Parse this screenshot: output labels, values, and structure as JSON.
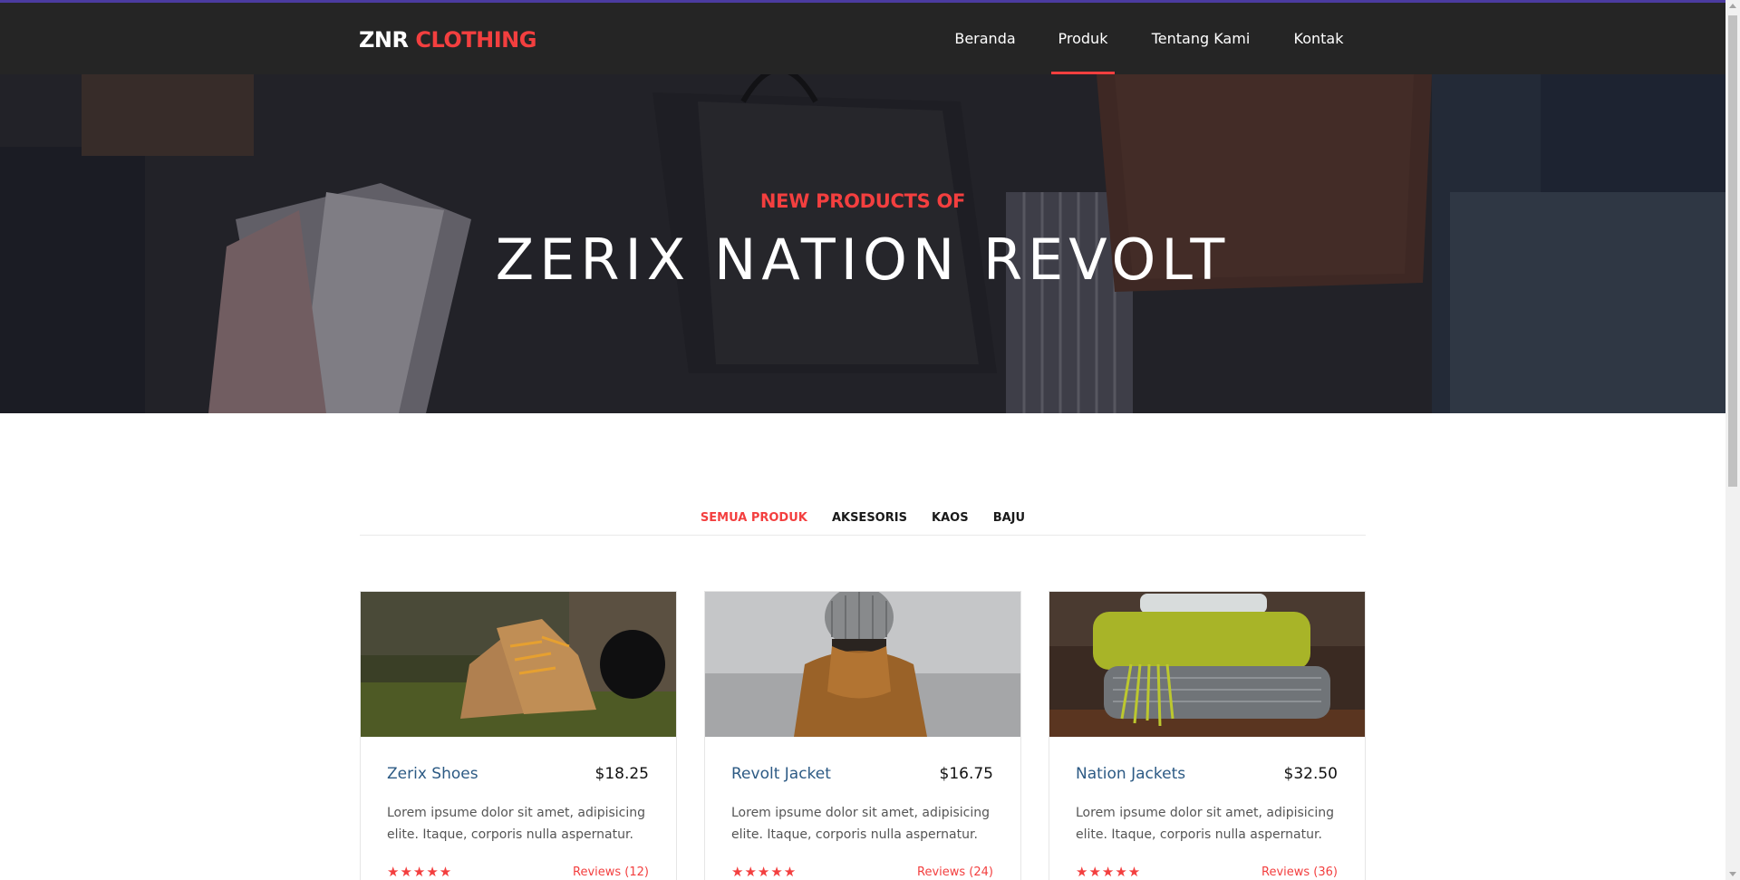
{
  "brand": {
    "part1": "ZNR",
    "part2": "CLOTHING"
  },
  "nav": {
    "items": [
      {
        "label": "Beranda"
      },
      {
        "label": "Produk"
      },
      {
        "label": "Tentang Kami"
      },
      {
        "label": "Kontak"
      }
    ],
    "active": "Produk"
  },
  "hero": {
    "subtitle": "NEW PRODUCTS OF",
    "title": "ZERIX NATION REVOLT"
  },
  "filters": {
    "items": [
      {
        "label": "SEMUA PRODUK"
      },
      {
        "label": "AKSESORIS"
      },
      {
        "label": "KAOS"
      },
      {
        "label": "BAJU"
      }
    ],
    "active": "SEMUA PRODUK"
  },
  "products": [
    {
      "name": "Zerix Shoes",
      "price": "$18.25",
      "description": "Lorem ipsume dolor sit amet, adipisicing elite. Itaque, corporis nulla aspernatur.",
      "rating": 5,
      "reviews": "Reviews (12)",
      "image": "boots-on-moss"
    },
    {
      "name": "Revolt Jacket",
      "price": "$16.75",
      "description": "Lorem ipsume dolor sit amet, adipisicing elite. Itaque, corporis nulla aspernatur.",
      "rating": 5,
      "reviews": "Reviews (24)",
      "image": "person-in-beanie-and-jacket"
    },
    {
      "name": "Nation Jackets",
      "price": "$32.50",
      "description": "Lorem ipsume dolor sit amet, adipisicing elite. Itaque, corporis nulla aspernatur.",
      "rating": 5,
      "reviews": "Reviews (36)",
      "image": "folded-knit-scarves"
    }
  ],
  "colors": {
    "accent": "#f33f3f",
    "navbar": "#252525",
    "product_name": "#2c5a84",
    "topline": "#4b3ba0"
  }
}
